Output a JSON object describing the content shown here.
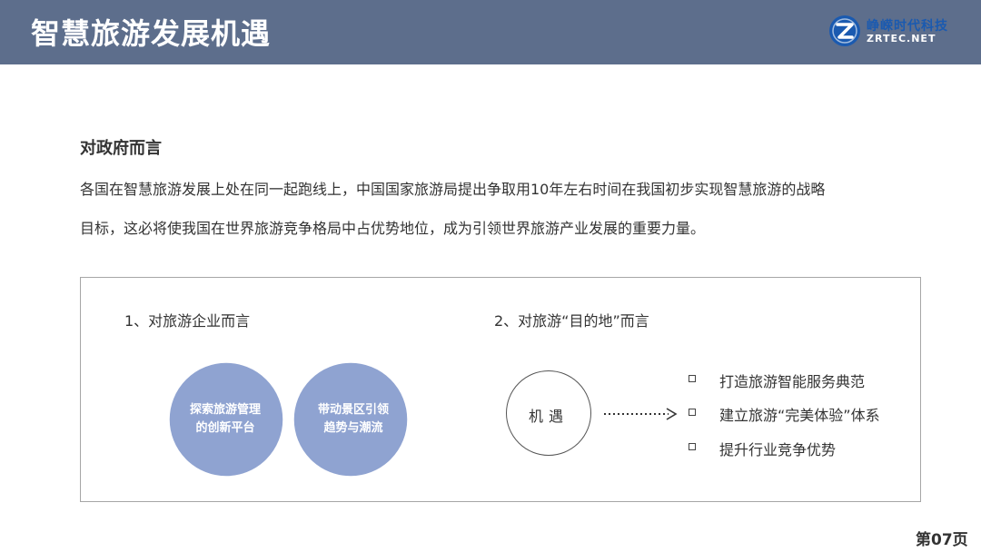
{
  "header": {
    "title": "智慧旅游发展机遇",
    "logo_cn": "峥嵘时代科技",
    "logo_en": "ZRTEC.NET",
    "bg_color": "#5d6e8c"
  },
  "government": {
    "heading": "对政府而言",
    "line1": "各国在智慧旅游发展上处在同一起跑线上，中国国家旅游局提出争取用10年左右时间在我国初步实现智慧旅游的战略",
    "line2": "目标，这必将使我国在世界旅游竞争格局中占优势地位，成为引领世界旅游产业发展的重要力量。"
  },
  "enterprise": {
    "heading": "1、对旅游企业而言",
    "circle_left": [
      "探索旅游管理",
      "的创新平台"
    ],
    "circle_right": [
      "带动景区引领",
      "趋势与潮流"
    ],
    "circle_color": "#8fa3d1",
    "overlap_color": "#7088c7"
  },
  "destination": {
    "heading": "2、对旅游“目的地”而言",
    "circle_label": "机遇",
    "items": [
      "打造旅游智能服务典范",
      "建立旅游“完美体验”体系",
      "提升行业竞争优势"
    ]
  },
  "footer": {
    "page": "第07页"
  }
}
